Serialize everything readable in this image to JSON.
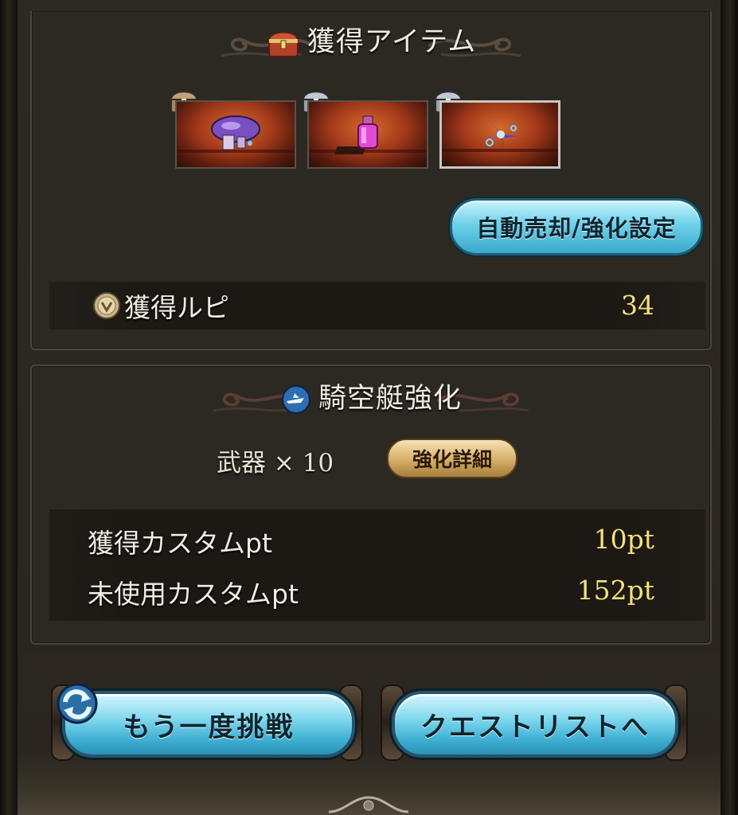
{
  "loot": {
    "title": "獲得アイテム",
    "items": [
      {
        "name": "mushroom",
        "badge": "wood-chest"
      },
      {
        "name": "pink-potion",
        "badge": "silver-chest"
      },
      {
        "name": "blue-flower",
        "badge": "silver-chest"
      }
    ],
    "auto_sell_button": "自動売却/強化設定",
    "rupie_label": "獲得ルピ",
    "rupie_value": "34"
  },
  "airship": {
    "title": "騎空艇強化",
    "weapon_label": "武器",
    "weapon_times": "×",
    "weapon_count": "10",
    "detail_button": "強化詳細",
    "earned_label": "獲得カスタムpt",
    "earned_value": "10pt",
    "unused_label": "未使用カスタムpt",
    "unused_value": "152pt"
  },
  "actions": {
    "retry_button": "もう一度挑戦",
    "quest_list_button": "クエストリストへ"
  },
  "colors": {
    "accent_yellow": "#f4e27a",
    "button_blue": "#6fd1ea",
    "button_gold": "#d9b36d"
  }
}
